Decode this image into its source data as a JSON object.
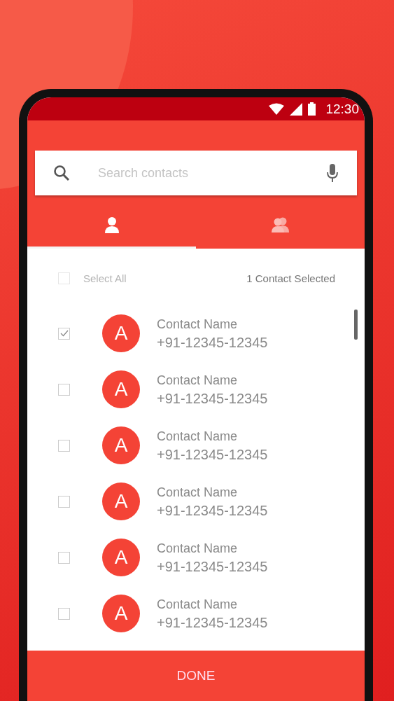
{
  "status_bar": {
    "time": "12:30"
  },
  "search": {
    "placeholder": "Search contacts"
  },
  "tabs": [
    {
      "kind": "person",
      "selected": true
    },
    {
      "kind": "group",
      "selected": false
    }
  ],
  "select_all": {
    "label": "Select All",
    "checked": false,
    "disabled": true
  },
  "selection_count": "1 Contact Selected",
  "contacts": [
    {
      "avatar_letter": "A",
      "name": "Contact Name",
      "phone": "+91-12345-12345",
      "checked": true
    },
    {
      "avatar_letter": "A",
      "name": "Contact Name",
      "phone": "+91-12345-12345",
      "checked": false
    },
    {
      "avatar_letter": "A",
      "name": "Contact Name",
      "phone": "+91-12345-12345",
      "checked": false
    },
    {
      "avatar_letter": "A",
      "name": "Contact Name",
      "phone": "+91-12345-12345",
      "checked": false
    },
    {
      "avatar_letter": "A",
      "name": "Contact Name",
      "phone": "+91-12345-12345",
      "checked": false
    },
    {
      "avatar_letter": "A",
      "name": "Contact Name",
      "phone": "+91-12345-12345",
      "checked": false
    }
  ],
  "done_button": "DONE"
}
